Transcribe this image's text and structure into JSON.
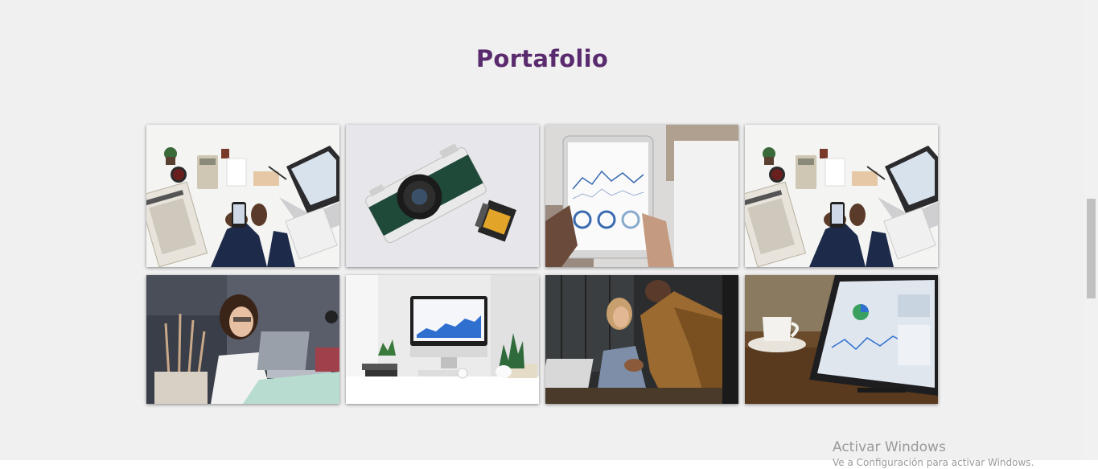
{
  "portfolio": {
    "title": "Portafolio",
    "items": [
      {
        "icon": "desk-business-photo"
      },
      {
        "icon": "camera-photo"
      },
      {
        "icon": "tablet-chart-photo"
      },
      {
        "icon": "desk-business-photo"
      },
      {
        "icon": "woman-laptop-photo"
      },
      {
        "icon": "imac-desk-photo"
      },
      {
        "icon": "meeting-photo"
      },
      {
        "icon": "tablet-analytics-photo"
      }
    ]
  },
  "os_watermark": {
    "line1": "Activar Windows",
    "line2": "Ve a Configuración para activar Windows."
  }
}
